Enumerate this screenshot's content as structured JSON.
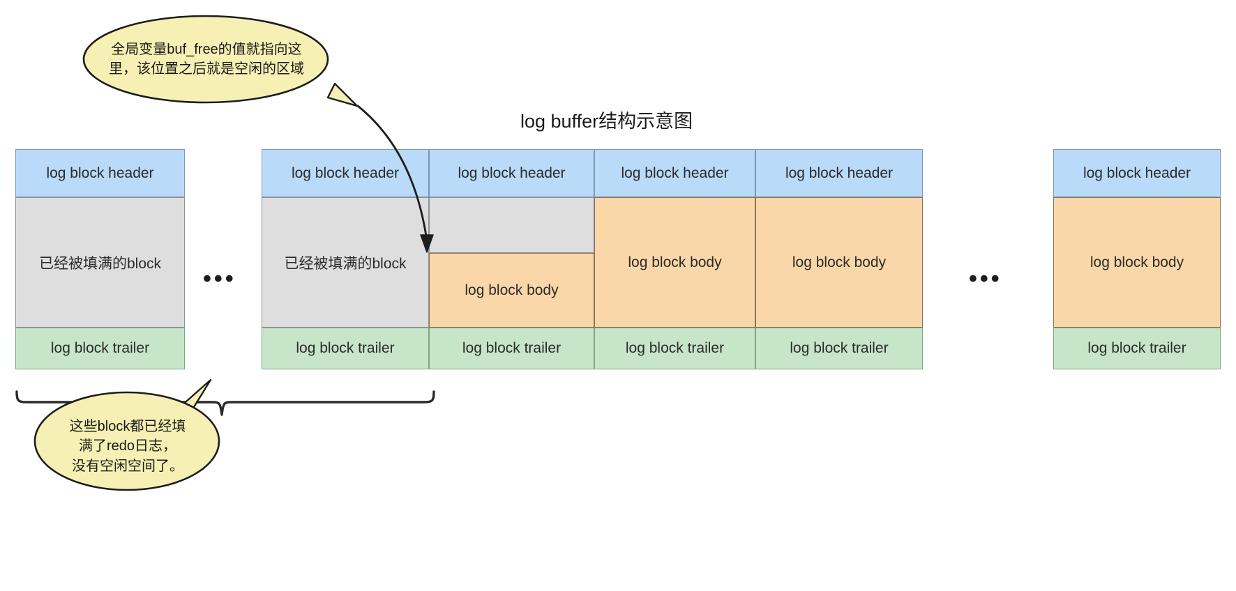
{
  "diagram": {
    "title": "log buffer结构示意图",
    "labels": {
      "header": "log block header",
      "body": "log block body",
      "trailer": "log block trailer",
      "filled": "已经被填满的block",
      "ellipsis": "•••"
    },
    "colors": {
      "header_fill": "#b9daf8",
      "filled_fill": "#dedede",
      "body_fill": "#fad7a8",
      "trailer_fill": "#c7e5c9",
      "callout_fill": "#f7f0b4",
      "stroke": "#1d1d1d"
    },
    "groups": [
      {
        "name": "left-standalone-block",
        "blocks": [
          {
            "header": "log block header",
            "middle": "已经被填满的block",
            "middle_kind": "filled",
            "trailer": "log block trailer"
          }
        ]
      },
      {
        "name": "middle-block-run",
        "blocks": [
          {
            "header": "log block header",
            "middle": "已经被填满的block",
            "middle_kind": "filled",
            "trailer": "log block trailer"
          },
          {
            "header": "log block header",
            "middle": "log block body",
            "middle_kind": "partial-body",
            "trailer": "log block trailer"
          },
          {
            "header": "log block header",
            "middle": "log block body",
            "middle_kind": "body",
            "trailer": "log block trailer"
          },
          {
            "header": "log block header",
            "middle": "log block body",
            "middle_kind": "body",
            "trailer": "log block trailer"
          }
        ]
      },
      {
        "name": "right-standalone-block",
        "blocks": [
          {
            "header": "log block header",
            "middle": "log block body",
            "middle_kind": "body",
            "trailer": "log block trailer"
          }
        ]
      }
    ],
    "ellipses": [
      {
        "name": "ellipsis-left",
        "text": "•••"
      },
      {
        "name": "ellipsis-right",
        "text": "•••"
      }
    ],
    "callouts": [
      {
        "name": "buf-free-callout",
        "text": "全局变量buf_free的值就指向这\n里，该位置之后就是空闲的区域"
      },
      {
        "name": "filled-blocks-callout",
        "text": "这些block都已经填\n满了redo日志，\n没有空闲空间了。"
      }
    ]
  }
}
